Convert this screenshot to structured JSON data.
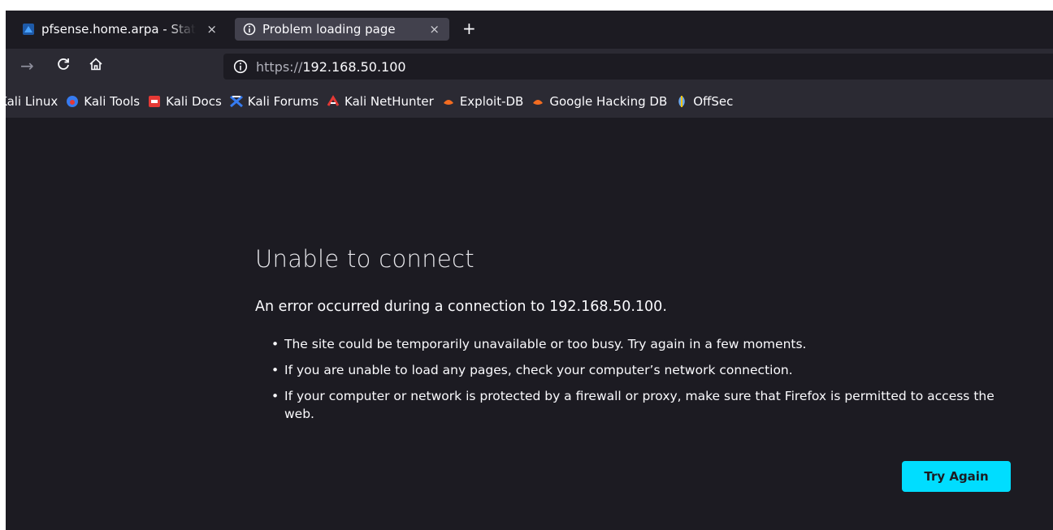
{
  "tabs": [
    {
      "title": "pfsense.home.arpa - Status: Dashboard",
      "close": "×",
      "favicon": "pfsense-icon"
    },
    {
      "title": "Problem loading page",
      "close": "×",
      "favicon": "info-icon"
    }
  ],
  "new_tab_label": "+",
  "nav": {
    "back": "→",
    "reload": "C",
    "home": "⌂"
  },
  "url": {
    "scheme": "https://",
    "host": "192.168.50.100"
  },
  "bookmarks": [
    {
      "label": "Kali Linux",
      "icon": "kali-linux-icon",
      "color": "#367bf0"
    },
    {
      "label": "Kali Tools",
      "icon": "kali-tools-icon",
      "color": "#367bf0"
    },
    {
      "label": "Kali Docs",
      "icon": "kali-docs-icon",
      "color": "#e53935"
    },
    {
      "label": "Kali Forums",
      "icon": "kali-forums-icon",
      "color": "#367bf0"
    },
    {
      "label": "Kali NetHunter",
      "icon": "kali-nethunter-icon",
      "color": "#e53935"
    },
    {
      "label": "Exploit-DB",
      "icon": "exploit-db-icon",
      "color": "#f36c21"
    },
    {
      "label": "Google Hacking DB",
      "icon": "google-hacking-db-icon",
      "color": "#f36c21"
    },
    {
      "label": "OffSec",
      "icon": "offsec-icon",
      "color": "#6aa8f0"
    }
  ],
  "error": {
    "title": "Unable to connect",
    "description": "An error occurred during a connection to 192.168.50.100.",
    "items": [
      "The site could be temporarily unavailable or too busy. Try again in a few moments.",
      "If you are unable to load any pages, check your computer’s network connection.",
      "If your computer or network is protected by a firewall or proxy, make sure that Firefox is permitted to access the web."
    ],
    "button": "Try Again"
  },
  "colors": {
    "accent": "#00ddff",
    "background": "#1c1b22",
    "toolbar": "#2b2a33",
    "selected_tab": "#42414d"
  }
}
